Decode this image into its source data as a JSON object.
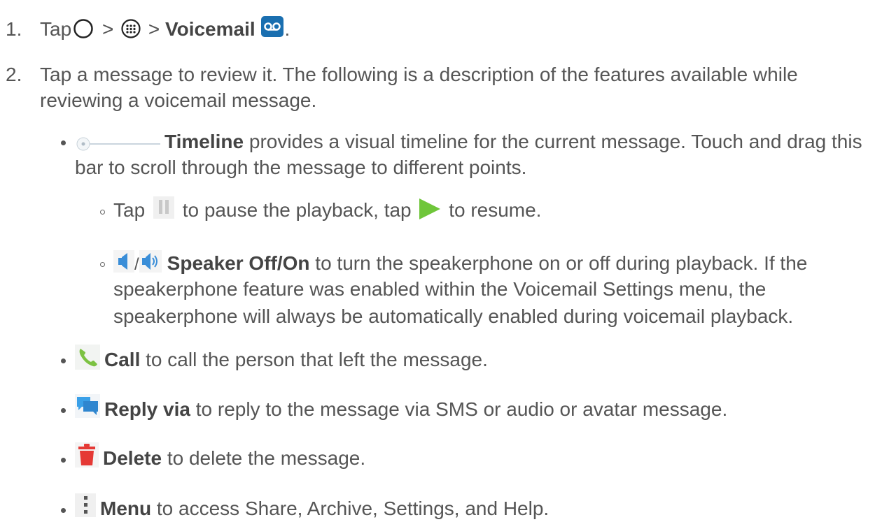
{
  "step1": {
    "number": "1.",
    "tap": "Tap",
    "sep1": ">",
    "sep2": ">",
    "voicemail": "Voicemail",
    "period": ".",
    "icons": [
      "home-icon",
      "apps-icon",
      "voicemail-icon"
    ]
  },
  "step2": {
    "number": "2.",
    "line1": "Tap a message to review it. The following is a description of the features available while",
    "line2": "reviewing a voicemail message."
  },
  "timeline": {
    "label": "Timeline",
    "text1": " provides a visual timeline for the current message. Touch and drag this",
    "text2": "bar to scroll through the message to different points."
  },
  "pause": {
    "tap": "Tap",
    "mid": "to pause the playback, tap",
    "end": "to resume."
  },
  "speaker": {
    "slash": "/",
    "label": "Speaker Off/On",
    "text1": " to turn the speakerphone on or off during playback. If the",
    "text2": "speakerphone feature was enabled within the Voicemail Settings menu, the",
    "text3": "speakerphone will always be automatically enabled during voicemail playback."
  },
  "call": {
    "label": "Call",
    "text": " to call the person that left the message."
  },
  "reply": {
    "label": "Reply via",
    "text": " to reply to the message via SMS or audio or avatar message."
  },
  "delete": {
    "label": "Delete",
    "text": " to delete the message."
  },
  "menu": {
    "label": "Menu",
    "text": " to access Share, Archive, Settings, and Help."
  },
  "colors": {
    "text": "#555555",
    "play_green": "#6fc63a",
    "delete_red": "#e53935",
    "call_green": "#7cc242",
    "reply_blue": "#3aa0e8",
    "voicemail_blue": "#1a6fb0"
  }
}
